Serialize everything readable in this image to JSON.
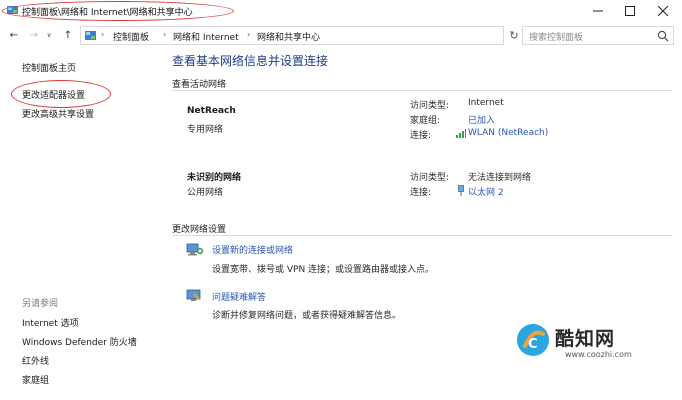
{
  "window": {
    "title": "控制面板\\网络和 Internet\\网络和共享中心",
    "minimize_icon": "minimize-icon",
    "maximize_icon": "maximize-icon",
    "close_icon": "close-icon"
  },
  "nav": {
    "back_glyph": "←",
    "forward_glyph": "→",
    "recent_glyph": "∨",
    "up_glyph": "↑",
    "breadcrumbs": [
      "控制面板",
      "网络和 Internet",
      "网络和共享中心"
    ],
    "separator": "›",
    "dropdown_glyph": "∨",
    "refresh_glyph": "↻",
    "search_placeholder": "搜索控制面板"
  },
  "sidebar": {
    "items": [
      "控制面板主页",
      "更改适配器设置",
      "更改高级共享设置"
    ],
    "see_also_label": "另请参阅",
    "see_also_items": [
      "Internet 选项",
      "Windows Defender 防火墙",
      "红外线",
      "家庭组"
    ]
  },
  "main": {
    "heading": "查看基本网络信息并设置连接",
    "active_section": "查看活动网络",
    "networks": [
      {
        "name": "NetReach",
        "type": "专用网络",
        "access_label": "访问类型:",
        "access_value": "Internet",
        "homegroup_label": "家庭组:",
        "homegroup_value": "已加入",
        "connection_label": "连接:",
        "connection_value": "WLAN (NetReach)",
        "connection_icon": "wifi-signal-icon"
      },
      {
        "name": "未识别的网络",
        "type": "公用网络",
        "access_label": "访问类型:",
        "access_value": "无法连接到网络",
        "connection_label": "连接:",
        "connection_value": "以太网 2",
        "connection_icon": "ethernet-icon"
      }
    ],
    "change_section": "更改网络设置",
    "settings": [
      {
        "link": "设置新的连接或网络",
        "desc": "设置宽带、拨号或 VPN 连接；或设置路由器或接入点。",
        "icon": "new-connection-icon"
      },
      {
        "link": "问题疑难解答",
        "desc": "诊断并修复网络问题，或者获得疑难解答信息。",
        "icon": "troubleshoot-icon"
      }
    ]
  },
  "watermark": {
    "name": "酷知网",
    "url": "www.coozhi.com"
  },
  "colors": {
    "link": "#2a56b4",
    "heading": "#1e3c8c",
    "annotation_red": "#d93a3a"
  }
}
